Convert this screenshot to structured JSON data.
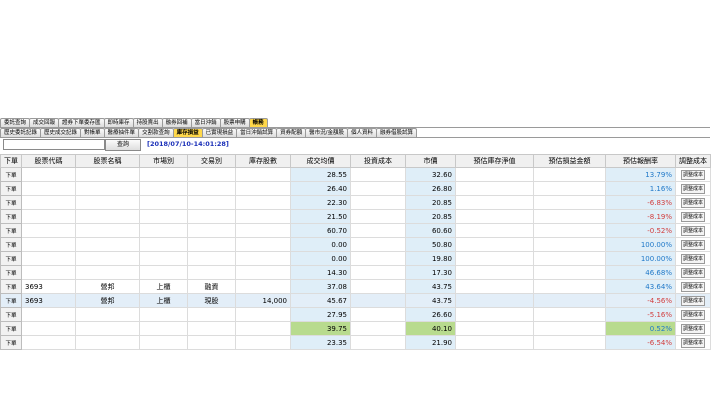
{
  "tabs_row1": [
    "委託查詢",
    "成交回報",
    "證券下單委存匯",
    "即時庫存",
    "持股賣出",
    "融券回補",
    "當日沖銷",
    "股票申購",
    "帳務"
  ],
  "tabs_row1_active": 8,
  "tabs_row2": [
    "歷史委託記錄",
    "歷史成交記錄",
    "對帳單",
    "醫療抽件單",
    "交割款查詢",
    "庫存損益",
    "已實現損益",
    "當日沖銷試算",
    "資券配額",
    "醫市況/金額股",
    "個人資料",
    "融券借股試算"
  ],
  "tabs_row2_active": 5,
  "toolbar": {
    "search_value": "",
    "query_label": "查詢",
    "timestamp": "[2018/07/10-14:01:28]"
  },
  "columns": [
    "下單",
    "股票代碼",
    "股票名稱",
    "市場別",
    "交易別",
    "庫存股數",
    "成交均價",
    "投資成本",
    "市價",
    "預估庫存淨值",
    "預估損益金額",
    "預估報酬率",
    "調整成本"
  ],
  "rows": [
    {
      "action": "下單",
      "code": "",
      "name": "",
      "market": "",
      "trade": "",
      "shares": "",
      "avg": "28.55",
      "cost": "",
      "price": "32.60",
      "nav": "",
      "pnl": "",
      "ret": "13.79%",
      "sign": "pos",
      "adj": "調整成本"
    },
    {
      "action": "下單",
      "code": "",
      "name": "",
      "market": "",
      "trade": "",
      "shares": "",
      "avg": "26.40",
      "cost": "",
      "price": "26.80",
      "nav": "",
      "pnl": "",
      "ret": "1.16%",
      "sign": "pos",
      "adj": "調整成本"
    },
    {
      "action": "下單",
      "code": "",
      "name": "",
      "market": "",
      "trade": "",
      "shares": "",
      "avg": "22.30",
      "cost": "",
      "price": "20.85",
      "nav": "",
      "pnl": "",
      "ret": "-6.83%",
      "sign": "neg",
      "adj": "調整成本"
    },
    {
      "action": "下單",
      "code": "",
      "name": "",
      "market": "",
      "trade": "",
      "shares": "",
      "avg": "21.50",
      "cost": "",
      "price": "20.85",
      "nav": "",
      "pnl": "",
      "ret": "-8.19%",
      "sign": "neg",
      "adj": "調整成本"
    },
    {
      "action": "下單",
      "code": "",
      "name": "",
      "market": "",
      "trade": "",
      "shares": "",
      "avg": "60.70",
      "cost": "",
      "price": "60.60",
      "nav": "",
      "pnl": "",
      "ret": "-0.52%",
      "sign": "neg",
      "adj": "調整成本"
    },
    {
      "action": "下單",
      "code": "",
      "name": "",
      "market": "",
      "trade": "",
      "shares": "",
      "avg": "0.00",
      "cost": "",
      "price": "50.80",
      "nav": "",
      "pnl": "",
      "ret": "100.00%",
      "sign": "pos",
      "adj": "調整成本"
    },
    {
      "action": "下單",
      "code": "",
      "name": "",
      "market": "",
      "trade": "",
      "shares": "",
      "avg": "0.00",
      "cost": "",
      "price": "19.80",
      "nav": "",
      "pnl": "",
      "ret": "100.00%",
      "sign": "pos",
      "adj": "調整成本"
    },
    {
      "action": "下單",
      "code": "",
      "name": "",
      "market": "",
      "trade": "",
      "shares": "",
      "avg": "14.30",
      "cost": "",
      "price": "17.30",
      "nav": "",
      "pnl": "",
      "ret": "46.68%",
      "sign": "pos",
      "adj": "調整成本"
    },
    {
      "action": "下單",
      "code": "3693",
      "name": "營邦",
      "market": "上櫃",
      "trade": "融資",
      "shares": "",
      "avg": "37.08",
      "cost": "",
      "price": "43.75",
      "nav": "",
      "pnl": "",
      "ret": "43.64%",
      "sign": "pos",
      "adj": "調整成本"
    },
    {
      "action": "下單",
      "code": "3693",
      "name": "營邦",
      "market": "上櫃",
      "trade": "現股",
      "shares": "14,000",
      "avg": "45.67",
      "cost": "",
      "price": "43.75",
      "nav": "",
      "pnl": "",
      "ret": "-4.56%",
      "sign": "neg",
      "adj": "調整成本",
      "selected": true
    },
    {
      "action": "下單",
      "code": "",
      "name": "",
      "market": "",
      "trade": "",
      "shares": "",
      "avg": "27.95",
      "cost": "",
      "price": "26.60",
      "nav": "",
      "pnl": "",
      "ret": "-5.16%",
      "sign": "neg",
      "adj": "調整成本"
    },
    {
      "action": "下單",
      "code": "",
      "name": "",
      "market": "",
      "trade": "",
      "shares": "",
      "avg": "39.75",
      "cost": "",
      "price": "40.10",
      "nav": "",
      "pnl": "",
      "ret": "0.52%",
      "sign": "pos",
      "adj": "調整成本",
      "highlight": true
    },
    {
      "action": "下單",
      "code": "",
      "name": "",
      "market": "",
      "trade": "",
      "shares": "",
      "avg": "23.35",
      "cost": "",
      "price": "21.90",
      "nav": "",
      "pnl": "",
      "ret": "-6.54%",
      "sign": "neg",
      "adj": "調整成本"
    }
  ]
}
